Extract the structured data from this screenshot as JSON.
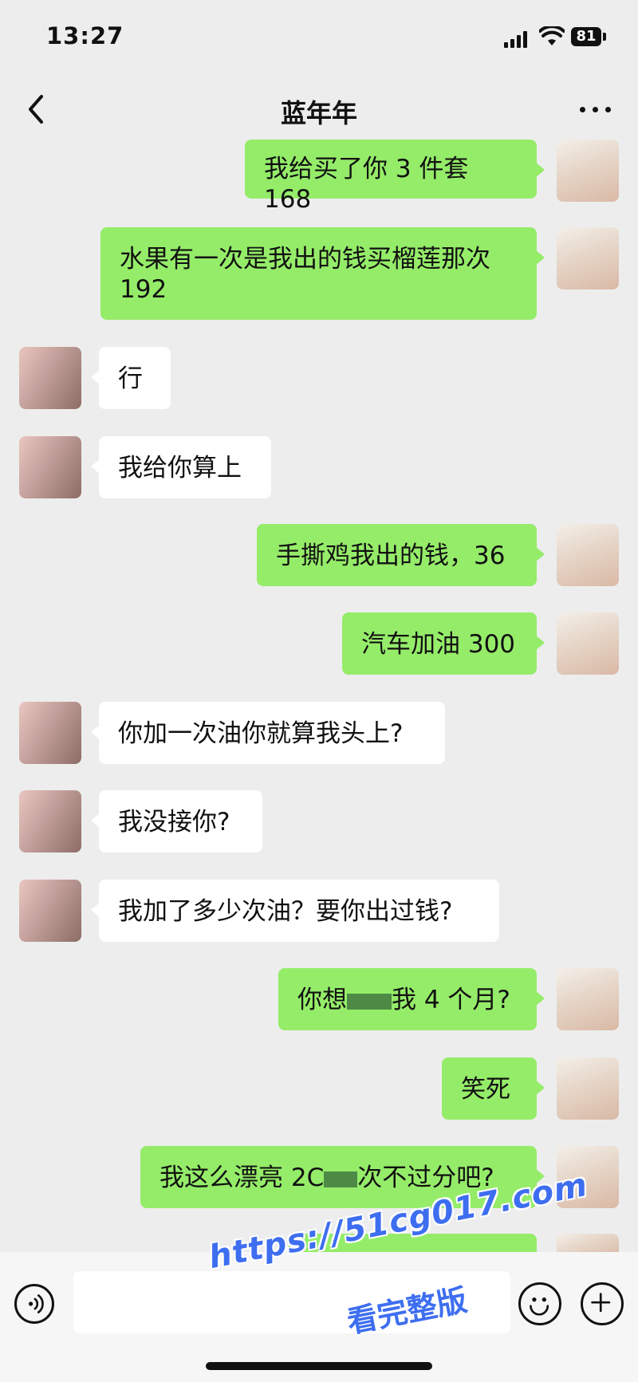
{
  "status_bar": {
    "time": "13:27",
    "battery": "81"
  },
  "nav": {
    "title": "蓝年年"
  },
  "messages": [
    {
      "side": "me",
      "text": "我给买了你 3 件套 168"
    },
    {
      "side": "me",
      "text": "水果有一次是我出的钱买榴莲那次\n192"
    },
    {
      "side": "them",
      "text": "行"
    },
    {
      "side": "them",
      "text": "我给你算上"
    },
    {
      "side": "me",
      "text": "手撕鸡我出的钱，36"
    },
    {
      "side": "me",
      "text": "汽车加油 300"
    },
    {
      "side": "them",
      "text": "你加一次油你就算我头上?"
    },
    {
      "side": "them",
      "text": "我没接你?"
    },
    {
      "side": "them",
      "text": "我加了多少次油？要你出过钱?"
    },
    {
      "side": "me",
      "text_before": "你想",
      "text_after": "我 4 个月?"
    },
    {
      "side": "me",
      "text": "笑死"
    },
    {
      "side": "me",
      "text_before": "我这么漂亮 2C",
      "text_after": "次不过分吧?"
    }
  ],
  "input_bar": {
    "voice_icon": "voice-icon",
    "emoji_icon": "emoji-icon",
    "plus_icon": "plus-icon"
  },
  "watermark": {
    "url": "https://51cg017.com",
    "caption": "看完整版",
    "color": "#3e6ef0"
  },
  "colors": {
    "my_bubble": "#95ec69",
    "their_bubble": "#ffffff",
    "background": "#ededed"
  }
}
